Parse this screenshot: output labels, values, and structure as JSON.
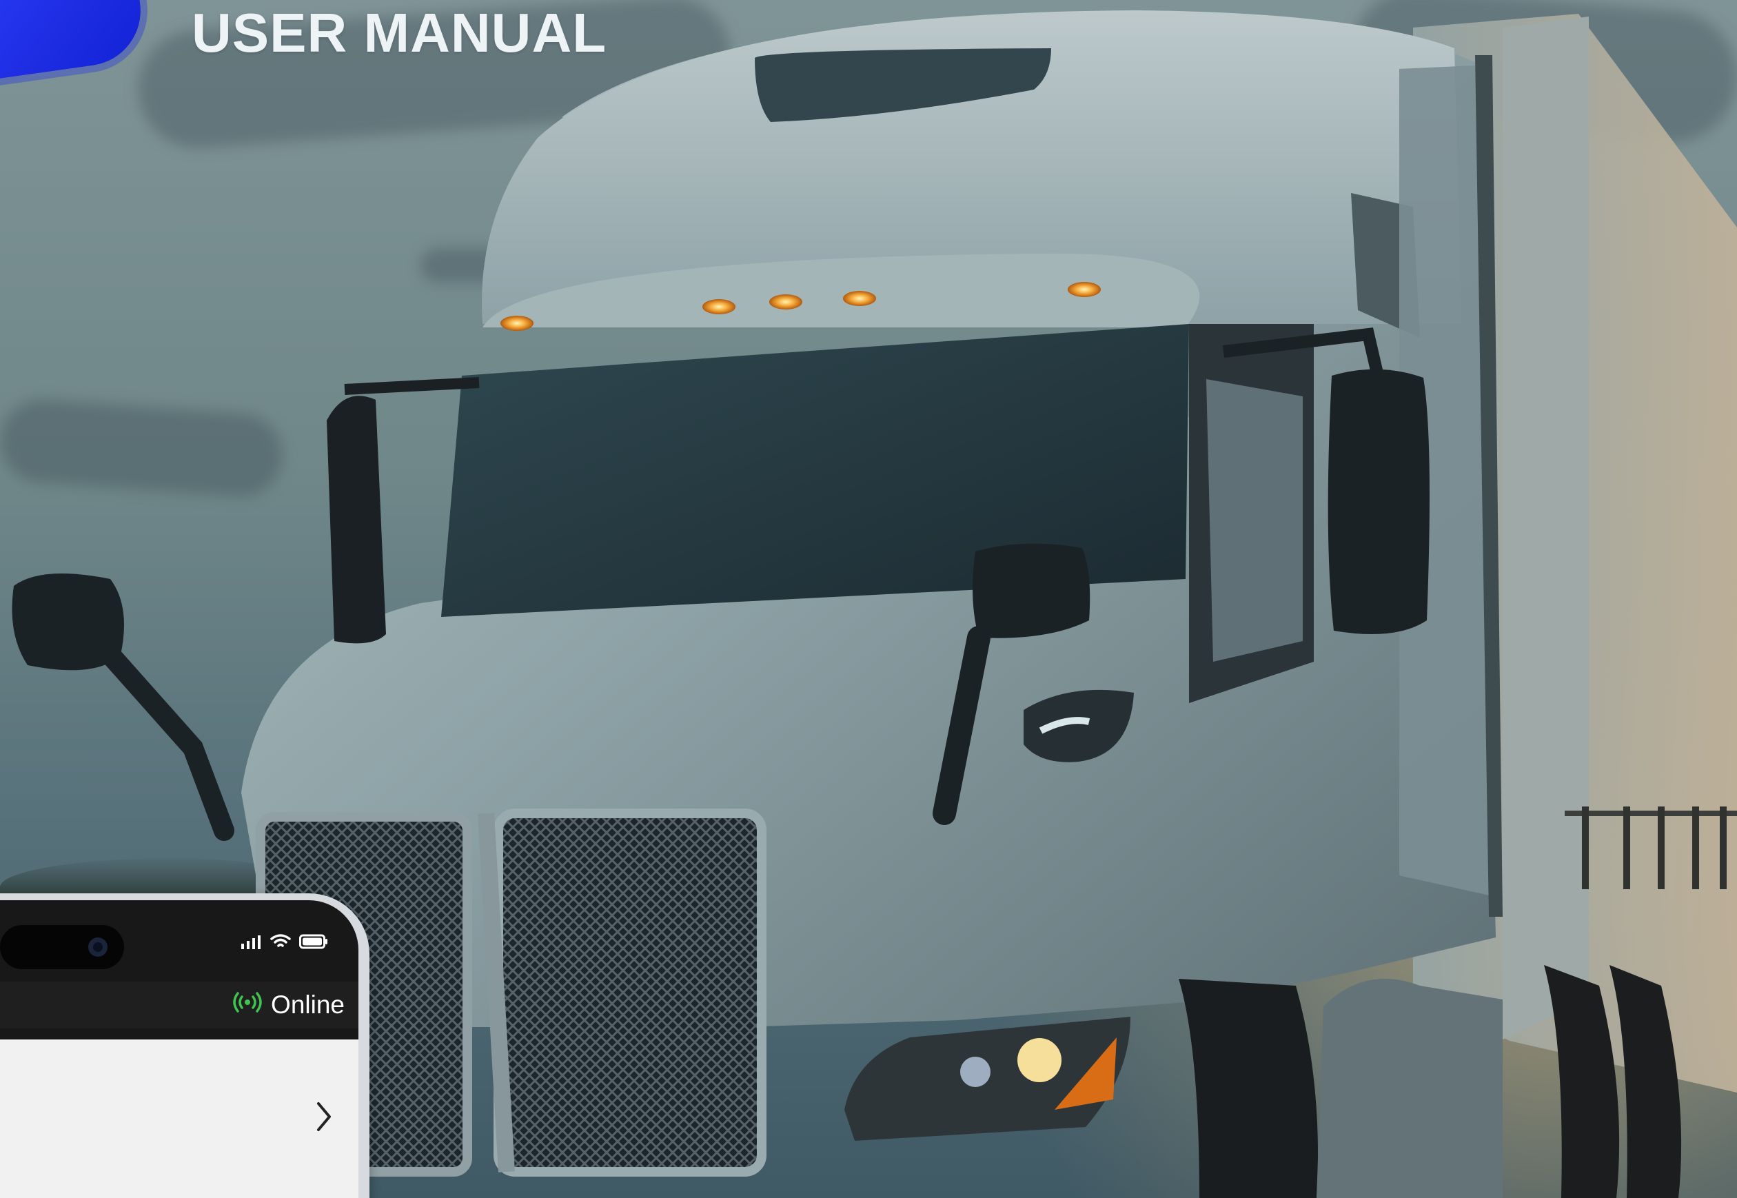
{
  "page": {
    "title": "USER MANUAL"
  },
  "phone": {
    "online_label": "Online"
  },
  "icons": {
    "logo": "logo-shape",
    "signal": "signal-icon",
    "wifi": "wifi-icon",
    "battery": "battery-icon",
    "online_indicator": "online-indicator-icon",
    "chevron": "chevron-right-icon"
  },
  "colors": {
    "logo_blue": "#1f2ee3",
    "online_green": "#41c34f"
  }
}
